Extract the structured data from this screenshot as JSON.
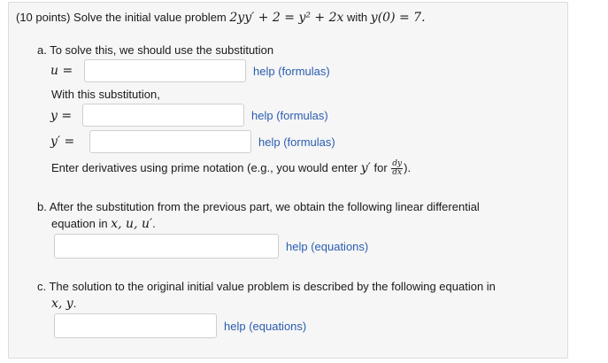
{
  "problem": {
    "points": "(10 points)",
    "lead": "Solve the initial value problem",
    "equation": "2yy′ + 2 = y² + 2x",
    "with": "with",
    "initial_condition": "y(0) = 7."
  },
  "part_a": {
    "intro": "a. To solve this, we should use the substitution",
    "u_label": "u =",
    "u_value": "",
    "help_u": "help (formulas)",
    "with_sub": "With this substitution,",
    "y_label": "y =",
    "y_value": "",
    "help_y": "help (formulas)",
    "yprime_label": "y′ =",
    "yprime_value": "",
    "help_yprime": "help (formulas)",
    "note_pre": "Enter derivatives using prime notation (e.g., you would enter",
    "note_var": "y′",
    "note_for": "for",
    "note_frac_num": "dy",
    "note_frac_den": "dx",
    "note_end": ")."
  },
  "part_b": {
    "line1": "b. After the substitution from the previous part, we obtain the following linear differential",
    "line2_pre": "equation in",
    "line2_vars": "x, u, u′",
    "line2_end": ".",
    "answer_value": "",
    "help": "help (equations)"
  },
  "part_c": {
    "line1": "c. The solution to the original initial value problem is described by the following equation in",
    "line2_vars": "x, y",
    "line2_end": ".",
    "answer_value": "",
    "help": "help (equations)"
  }
}
